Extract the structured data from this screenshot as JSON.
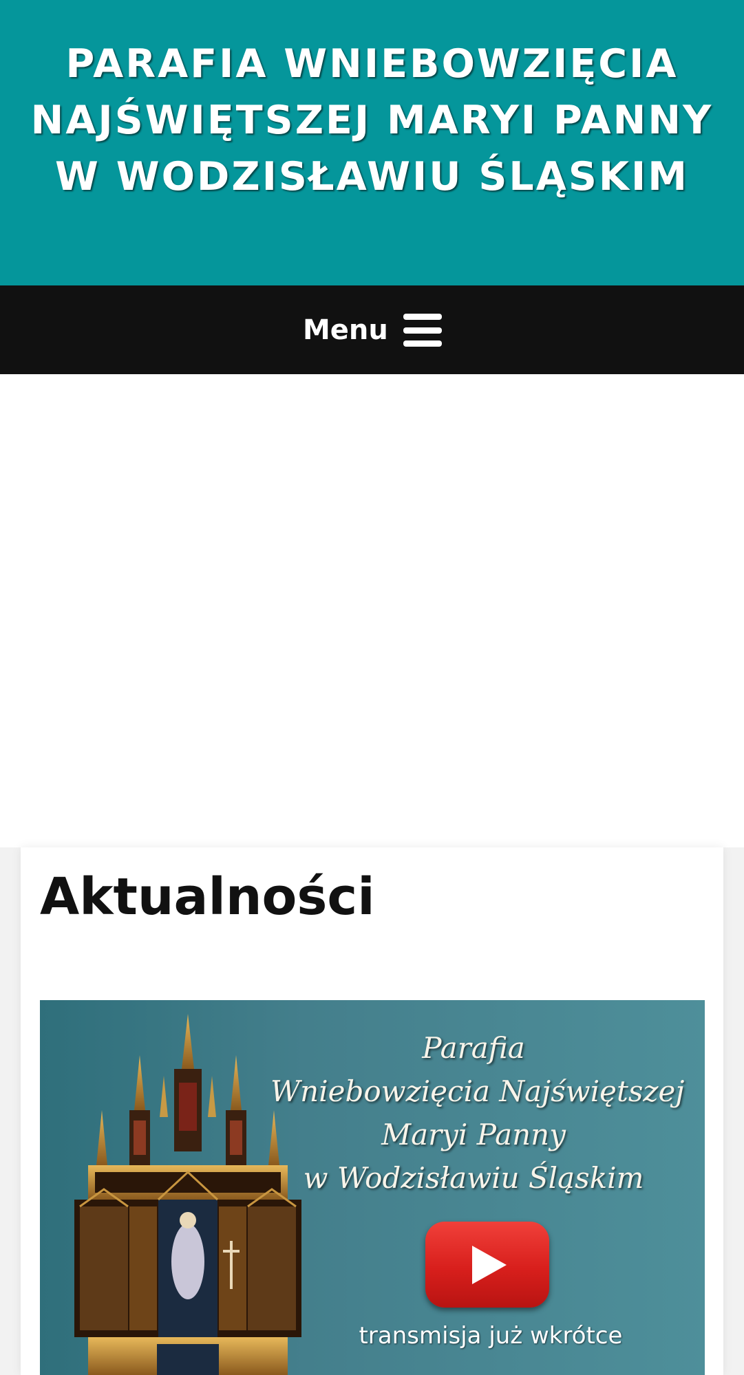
{
  "header": {
    "title_lines": [
      "PARAFIA WNIEBOWZIĘCIA",
      "NAJŚWIĘTSZEJ MARYI PANNY",
      "W WODZISŁAWIU ŚLĄSKIM"
    ],
    "background_color": "#05969b"
  },
  "nav": {
    "menu_label": "Menu",
    "menu_icon": "hamburger-icon",
    "background_color": "#111111"
  },
  "main": {
    "section_title": "Aktualności",
    "banner": {
      "lines": [
        "Parafia",
        "Wniebowzięcia  Najświętszej",
        "Maryi Panny",
        "w Wodzisławiu Śląskim"
      ],
      "caption": "transmisja już wkrótce",
      "play_icon": "youtube-play-icon",
      "play_color": "#e02a26"
    }
  }
}
